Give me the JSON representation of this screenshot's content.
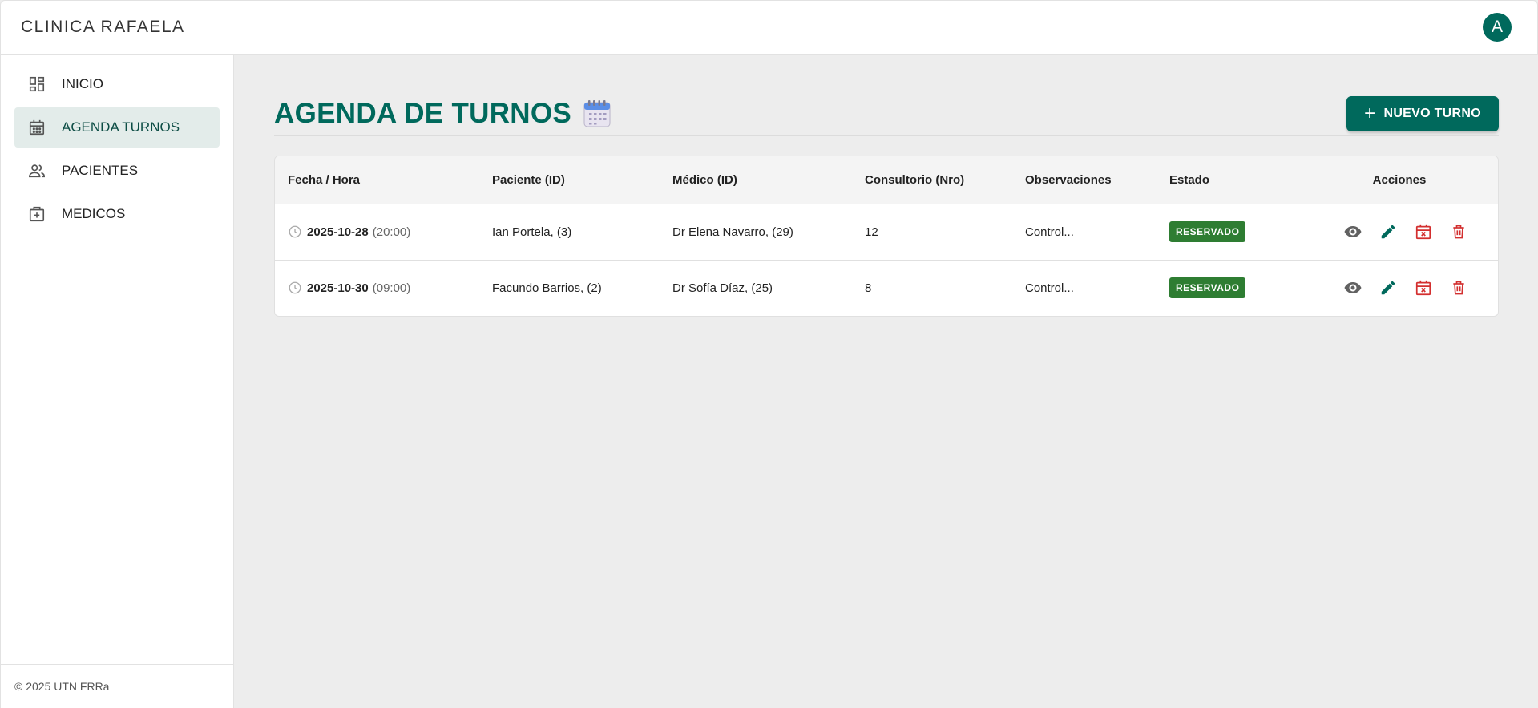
{
  "app": {
    "brand": "CLINICA RAFAELA",
    "avatar_initial": "A"
  },
  "sidebar": {
    "items": [
      {
        "label": "INICIO",
        "icon": "dashboard-icon",
        "active": false
      },
      {
        "label": "AGENDA TURNOS",
        "icon": "calendar-icon",
        "active": true
      },
      {
        "label": "PACIENTES",
        "icon": "people-icon",
        "active": false
      },
      {
        "label": "MEDICOS",
        "icon": "medical-bag-icon",
        "active": false
      }
    ],
    "footer": "© 2025 UTN FRRa"
  },
  "page": {
    "title": "AGENDA DE TURNOS",
    "title_icon": "calendar-emoji-icon",
    "new_button_label": "NUEVO TURNO"
  },
  "table": {
    "headers": [
      "Fecha / Hora",
      "Paciente (ID)",
      "Médico (ID)",
      "Consultorio (Nro)",
      "Observaciones",
      "Estado",
      "Acciones"
    ],
    "rows": [
      {
        "date": "2025-10-28",
        "time": "(20:00)",
        "paciente": "Ian Portela, (3)",
        "medico": "Dr Elena Navarro, (29)",
        "consultorio": "12",
        "observaciones": "Control...",
        "estado": "RESERVADO"
      },
      {
        "date": "2025-10-30",
        "time": "(09:00)",
        "paciente": "Facundo Barrios, (2)",
        "medico": "Dr Sofía Díaz, (25)",
        "consultorio": "8",
        "observaciones": "Control...",
        "estado": "RESERVADO"
      }
    ]
  },
  "colors": {
    "primary": "#00695c",
    "status_reserved": "#2e7d32",
    "danger": "#d32f2f",
    "icon_grey": "#616161"
  }
}
